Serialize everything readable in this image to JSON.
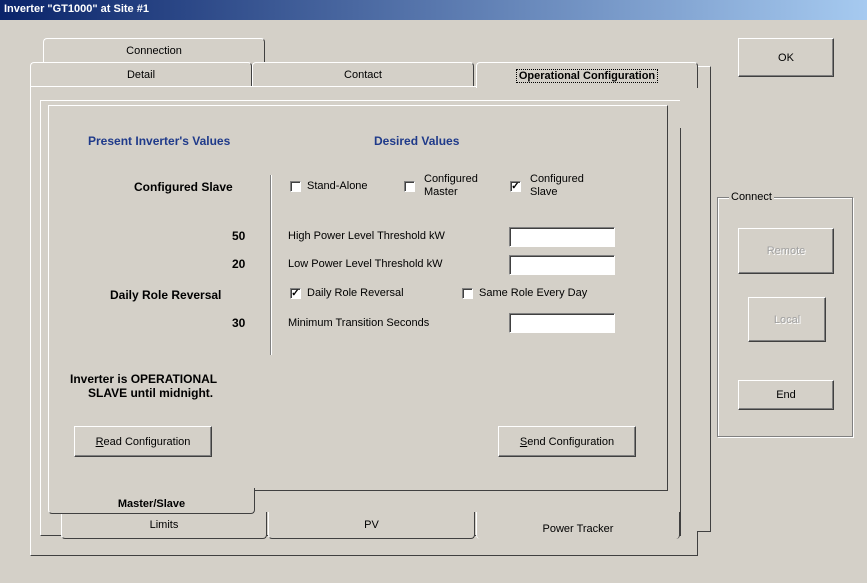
{
  "window": {
    "title": "Inverter \"GT1000\" at Site #1"
  },
  "tabs_top": {
    "connection": "Connection",
    "detail": "Detail",
    "contact": "Contact",
    "operational": "Operational Configuration"
  },
  "tabs_bottom": {
    "master_slave": "Master/Slave",
    "limits": "Limits",
    "pv": "PV",
    "power_tracker": "Power Tracker"
  },
  "present": {
    "heading": "Present Inverter's Values",
    "role": "Configured Slave",
    "high_power": "50",
    "low_power": "20",
    "daily_reversal": "Daily Role Reversal",
    "min_transition": "30",
    "status_line1": "Inverter is OPERATIONAL",
    "status_line2": "SLAVE until midnight."
  },
  "desired": {
    "heading": "Desired Values",
    "stand_alone": "Stand-Alone",
    "configured_master_1": "Configured",
    "configured_master_2": "Master",
    "configured_slave_1": "Configured",
    "configured_slave_2": "Slave",
    "high_power_label": "High Power Level Threshold kW",
    "low_power_label": "Low Power Level Threshold kW",
    "daily_role_reversal": "Daily Role Reversal",
    "same_role": "Same Role Every Day",
    "min_transition_label": "Minimum Transition Seconds",
    "high_power_value": "",
    "low_power_value": "",
    "min_transition_value": "",
    "checked_mark": "✓",
    "stand_alone_checked": false,
    "configured_master_checked": false,
    "configured_slave_checked": true,
    "daily_role_reversal_checked": true,
    "same_role_checked": false
  },
  "buttons": {
    "read_config_u": "R",
    "read_config_rest": "ead Configuration",
    "send_config_u": "S",
    "send_config_rest": "end Configuration",
    "ok": "OK",
    "remote": "Remote",
    "local": "Local",
    "end": "End"
  },
  "connect_group": {
    "label": "Connect"
  }
}
